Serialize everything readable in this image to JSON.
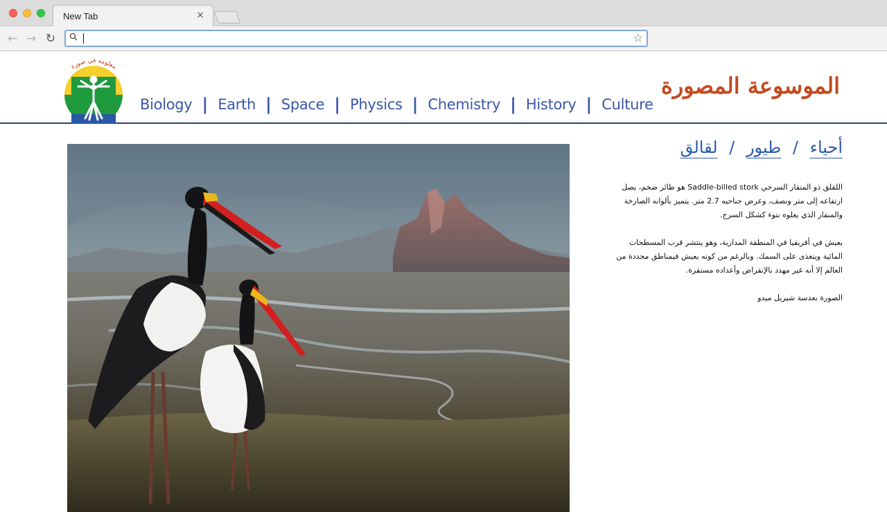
{
  "browser": {
    "tab_title": "New Tab",
    "tab_close": "×",
    "address_value": "",
    "address_placeholder": ""
  },
  "site": {
    "logo_text": "معلومة في صورة",
    "title": "الموسوعة المصورة",
    "nav": [
      {
        "label": "Biology"
      },
      {
        "label": "Earth"
      },
      {
        "label": "Space"
      },
      {
        "label": "Physics"
      },
      {
        "label": "Chemistry"
      },
      {
        "label": "History"
      },
      {
        "label": "Culture"
      }
    ],
    "nav_separator": "|"
  },
  "breadcrumb": {
    "items": [
      "أحياء",
      "طيور",
      "لقالق"
    ],
    "separator": "/"
  },
  "article": {
    "paragraph_1": "اللقلق ذو المنقار السرجي Saddle-billed stork هو طائر ضخم، يصل ارتفاعه إلى متر ونصف، وعرض جناحيه 2.7 متر. يتميز بألوانه الصارخة والمنقار الذي يعلوه نتوء كشكل السرج.",
    "paragraph_2": "يعيش في أفريقيا في المنطقة المدارية، وهو ينتشر قرب المسطحات المائية ويتغذى على السمك. وبالرغم من كونه يعيش فيمناطق محددة من العالم إلا أنه غير مهدد بالإنقراض وأعداده مستقرة.",
    "credit": "الصورة بعدسة شيريل ميدو"
  },
  "colors": {
    "nav_link": "#3a56a8",
    "site_title": "#c44a1f",
    "breadcrumb": "#2a5bab",
    "header_rule": "#2a4562"
  }
}
